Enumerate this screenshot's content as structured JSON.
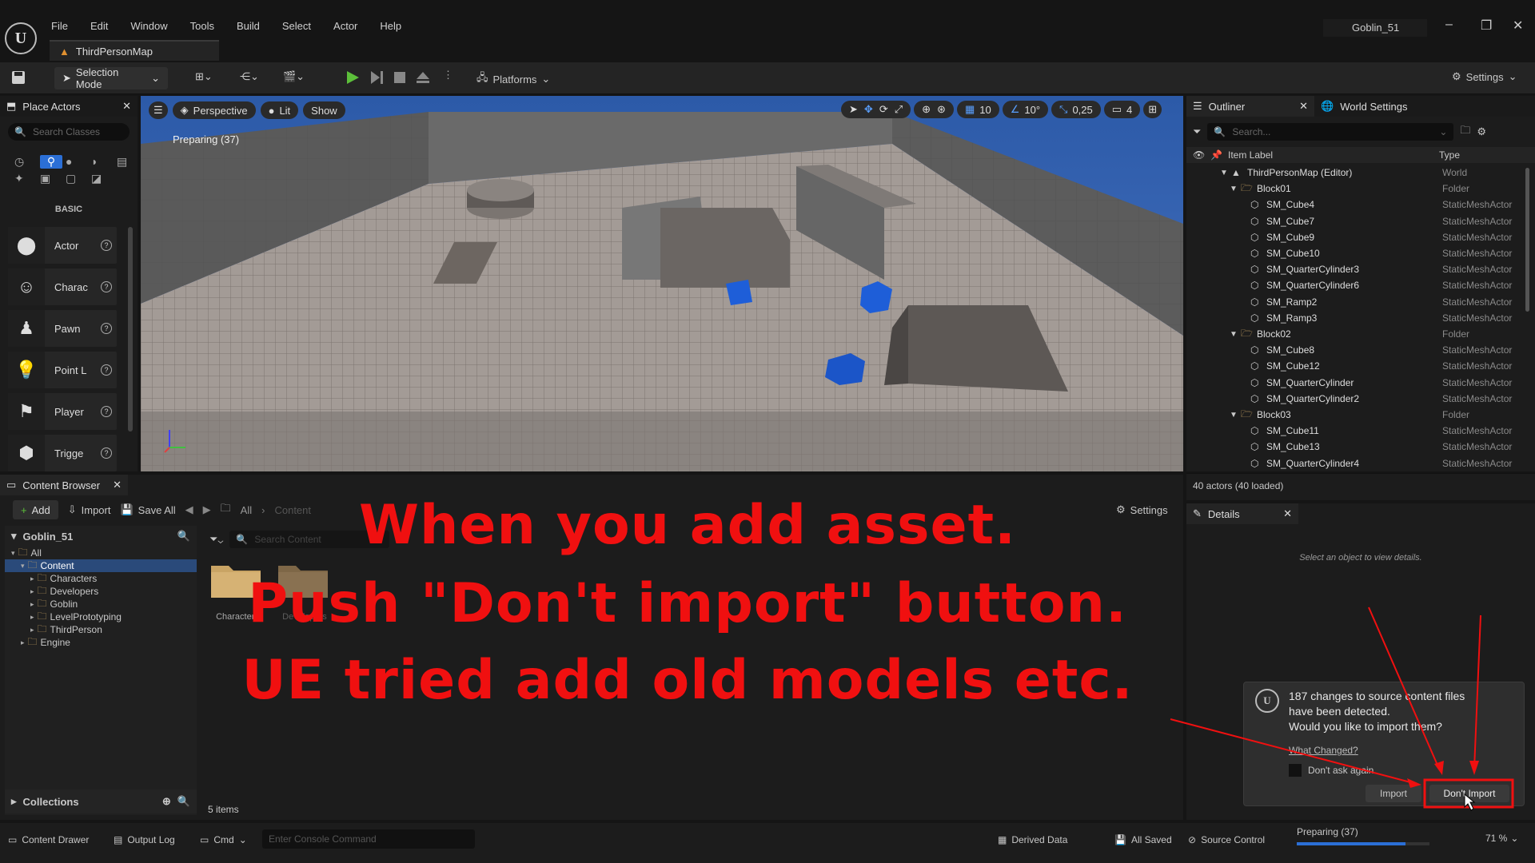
{
  "app": {
    "logo": "ue-logo",
    "map_tab": "ThirdPersonMap",
    "project": "Goblin_51"
  },
  "menu": [
    "File",
    "Edit",
    "Window",
    "Tools",
    "Build",
    "Select",
    "Actor",
    "Help"
  ],
  "toolbar": {
    "selection_mode": "Selection Mode",
    "platforms": "Platforms",
    "settings": "Settings"
  },
  "place_actors": {
    "tab": "Place Actors",
    "search_placeholder": "Search Classes",
    "category": "BASIC",
    "items": [
      {
        "label": "Actor",
        "icon": "sphere-icon"
      },
      {
        "label": "Charac",
        "icon": "character-icon"
      },
      {
        "label": "Pawn",
        "icon": "pawn-icon"
      },
      {
        "label": "Point L",
        "icon": "light-bulb-icon"
      },
      {
        "label": "Player",
        "icon": "player-start-icon"
      },
      {
        "label": "Trigge",
        "icon": "trigger-icon"
      }
    ]
  },
  "viewport": {
    "perspective": "Perspective",
    "lit": "Lit",
    "show": "Show",
    "status": "Preparing (37)",
    "grid": "10",
    "angle": "10°",
    "scale": "0,25",
    "camera_speed": "4"
  },
  "outliner": {
    "tab": "Outliner",
    "world_settings_tab": "World Settings",
    "search_placeholder": "Search...",
    "col_label": "Item Label",
    "col_type": "Type",
    "footer": "40 actors (40 loaded)",
    "rows": [
      {
        "label": "ThirdPersonMap (Editor)",
        "type": "World",
        "kind": "world",
        "indent": 0
      },
      {
        "label": "Block01",
        "type": "Folder",
        "kind": "folder",
        "indent": 1
      },
      {
        "label": "SM_Cube4",
        "type": "StaticMeshActor",
        "kind": "mesh",
        "indent": 2
      },
      {
        "label": "SM_Cube7",
        "type": "StaticMeshActor",
        "kind": "mesh",
        "indent": 2
      },
      {
        "label": "SM_Cube9",
        "type": "StaticMeshActor",
        "kind": "mesh",
        "indent": 2
      },
      {
        "label": "SM_Cube10",
        "type": "StaticMeshActor",
        "kind": "mesh",
        "indent": 2
      },
      {
        "label": "SM_QuarterCylinder3",
        "type": "StaticMeshActor",
        "kind": "mesh",
        "indent": 2
      },
      {
        "label": "SM_QuarterCylinder6",
        "type": "StaticMeshActor",
        "kind": "mesh",
        "indent": 2
      },
      {
        "label": "SM_Ramp2",
        "type": "StaticMeshActor",
        "kind": "mesh",
        "indent": 2
      },
      {
        "label": "SM_Ramp3",
        "type": "StaticMeshActor",
        "kind": "mesh",
        "indent": 2
      },
      {
        "label": "Block02",
        "type": "Folder",
        "kind": "folder",
        "indent": 1
      },
      {
        "label": "SM_Cube8",
        "type": "StaticMeshActor",
        "kind": "mesh",
        "indent": 2
      },
      {
        "label": "SM_Cube12",
        "type": "StaticMeshActor",
        "kind": "mesh",
        "indent": 2
      },
      {
        "label": "SM_QuarterCylinder",
        "type": "StaticMeshActor",
        "kind": "mesh",
        "indent": 2
      },
      {
        "label": "SM_QuarterCylinder2",
        "type": "StaticMeshActor",
        "kind": "mesh",
        "indent": 2
      },
      {
        "label": "Block03",
        "type": "Folder",
        "kind": "folder",
        "indent": 1
      },
      {
        "label": "SM_Cube11",
        "type": "StaticMeshActor",
        "kind": "mesh",
        "indent": 2
      },
      {
        "label": "SM_Cube13",
        "type": "StaticMeshActor",
        "kind": "mesh",
        "indent": 2
      },
      {
        "label": "SM_QuarterCylinder4",
        "type": "StaticMeshActor",
        "kind": "mesh",
        "indent": 2
      }
    ]
  },
  "content_browser": {
    "tab": "Content Browser",
    "add": "Add",
    "import": "Import",
    "save_all": "Save All",
    "path_all": "All",
    "path_content": "Content",
    "settings": "Settings",
    "root": "Goblin_51",
    "search_placeholder": "Search Content",
    "item_count": "5 items",
    "tree": [
      {
        "label": "All",
        "indent": 0,
        "selected": false
      },
      {
        "label": "Content",
        "indent": 1,
        "selected": true
      },
      {
        "label": "Characters",
        "indent": 2,
        "selected": false
      },
      {
        "label": "Developers",
        "indent": 2,
        "selected": false
      },
      {
        "label": "Goblin",
        "indent": 2,
        "selected": false
      },
      {
        "label": "LevelPrototyping",
        "indent": 2,
        "selected": false
      },
      {
        "label": "ThirdPerson",
        "indent": 2,
        "selected": false
      },
      {
        "label": "Engine",
        "indent": 1,
        "selected": false
      }
    ],
    "assets": [
      "Characters",
      "Developers"
    ],
    "collections": "Collections"
  },
  "details": {
    "tab": "Details",
    "empty": "Select an object to view details."
  },
  "notification": {
    "line1": "187 changes to source content files",
    "line2": "have been detected.",
    "line3": "Would you like to import them?",
    "what_changed": "What Changed?",
    "dont_ask": "Don't ask again",
    "import": "Import",
    "dont_import": "Don't Import"
  },
  "overlay": {
    "line1": "When you add asset.",
    "line2": "Push \"Don't import\" button.",
    "line3": "UE tried add old models etc."
  },
  "statusbar": {
    "content_drawer": "Content Drawer",
    "output_log": "Output Log",
    "cmd": "Cmd",
    "console_placeholder": "Enter Console Command",
    "derived_data": "Derived Data",
    "all_saved": "All Saved",
    "source_control": "Source Control",
    "preparing": "Preparing (37)",
    "progress": 0.82,
    "zoom": "71 %"
  },
  "colors": {
    "accent": "#2b6fd6",
    "annotation": "#f01010"
  }
}
